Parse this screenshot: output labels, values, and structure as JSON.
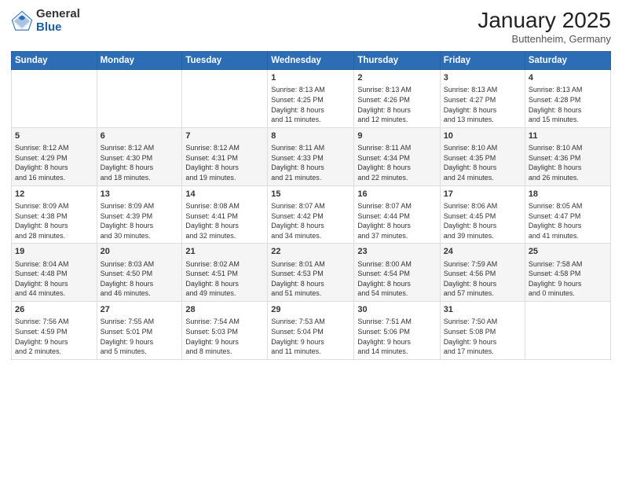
{
  "logo": {
    "general": "General",
    "blue": "Blue"
  },
  "header": {
    "month": "January 2025",
    "location": "Buttenheim, Germany"
  },
  "weekdays": [
    "Sunday",
    "Monday",
    "Tuesday",
    "Wednesday",
    "Thursday",
    "Friday",
    "Saturday"
  ],
  "weeks": [
    [
      {
        "day": "",
        "info": ""
      },
      {
        "day": "",
        "info": ""
      },
      {
        "day": "",
        "info": ""
      },
      {
        "day": "1",
        "info": "Sunrise: 8:13 AM\nSunset: 4:25 PM\nDaylight: 8 hours\nand 11 minutes."
      },
      {
        "day": "2",
        "info": "Sunrise: 8:13 AM\nSunset: 4:26 PM\nDaylight: 8 hours\nand 12 minutes."
      },
      {
        "day": "3",
        "info": "Sunrise: 8:13 AM\nSunset: 4:27 PM\nDaylight: 8 hours\nand 13 minutes."
      },
      {
        "day": "4",
        "info": "Sunrise: 8:13 AM\nSunset: 4:28 PM\nDaylight: 8 hours\nand 15 minutes."
      }
    ],
    [
      {
        "day": "5",
        "info": "Sunrise: 8:12 AM\nSunset: 4:29 PM\nDaylight: 8 hours\nand 16 minutes."
      },
      {
        "day": "6",
        "info": "Sunrise: 8:12 AM\nSunset: 4:30 PM\nDaylight: 8 hours\nand 18 minutes."
      },
      {
        "day": "7",
        "info": "Sunrise: 8:12 AM\nSunset: 4:31 PM\nDaylight: 8 hours\nand 19 minutes."
      },
      {
        "day": "8",
        "info": "Sunrise: 8:11 AM\nSunset: 4:33 PM\nDaylight: 8 hours\nand 21 minutes."
      },
      {
        "day": "9",
        "info": "Sunrise: 8:11 AM\nSunset: 4:34 PM\nDaylight: 8 hours\nand 22 minutes."
      },
      {
        "day": "10",
        "info": "Sunrise: 8:10 AM\nSunset: 4:35 PM\nDaylight: 8 hours\nand 24 minutes."
      },
      {
        "day": "11",
        "info": "Sunrise: 8:10 AM\nSunset: 4:36 PM\nDaylight: 8 hours\nand 26 minutes."
      }
    ],
    [
      {
        "day": "12",
        "info": "Sunrise: 8:09 AM\nSunset: 4:38 PM\nDaylight: 8 hours\nand 28 minutes."
      },
      {
        "day": "13",
        "info": "Sunrise: 8:09 AM\nSunset: 4:39 PM\nDaylight: 8 hours\nand 30 minutes."
      },
      {
        "day": "14",
        "info": "Sunrise: 8:08 AM\nSunset: 4:41 PM\nDaylight: 8 hours\nand 32 minutes."
      },
      {
        "day": "15",
        "info": "Sunrise: 8:07 AM\nSunset: 4:42 PM\nDaylight: 8 hours\nand 34 minutes."
      },
      {
        "day": "16",
        "info": "Sunrise: 8:07 AM\nSunset: 4:44 PM\nDaylight: 8 hours\nand 37 minutes."
      },
      {
        "day": "17",
        "info": "Sunrise: 8:06 AM\nSunset: 4:45 PM\nDaylight: 8 hours\nand 39 minutes."
      },
      {
        "day": "18",
        "info": "Sunrise: 8:05 AM\nSunset: 4:47 PM\nDaylight: 8 hours\nand 41 minutes."
      }
    ],
    [
      {
        "day": "19",
        "info": "Sunrise: 8:04 AM\nSunset: 4:48 PM\nDaylight: 8 hours\nand 44 minutes."
      },
      {
        "day": "20",
        "info": "Sunrise: 8:03 AM\nSunset: 4:50 PM\nDaylight: 8 hours\nand 46 minutes."
      },
      {
        "day": "21",
        "info": "Sunrise: 8:02 AM\nSunset: 4:51 PM\nDaylight: 8 hours\nand 49 minutes."
      },
      {
        "day": "22",
        "info": "Sunrise: 8:01 AM\nSunset: 4:53 PM\nDaylight: 8 hours\nand 51 minutes."
      },
      {
        "day": "23",
        "info": "Sunrise: 8:00 AM\nSunset: 4:54 PM\nDaylight: 8 hours\nand 54 minutes."
      },
      {
        "day": "24",
        "info": "Sunrise: 7:59 AM\nSunset: 4:56 PM\nDaylight: 8 hours\nand 57 minutes."
      },
      {
        "day": "25",
        "info": "Sunrise: 7:58 AM\nSunset: 4:58 PM\nDaylight: 9 hours\nand 0 minutes."
      }
    ],
    [
      {
        "day": "26",
        "info": "Sunrise: 7:56 AM\nSunset: 4:59 PM\nDaylight: 9 hours\nand 2 minutes."
      },
      {
        "day": "27",
        "info": "Sunrise: 7:55 AM\nSunset: 5:01 PM\nDaylight: 9 hours\nand 5 minutes."
      },
      {
        "day": "28",
        "info": "Sunrise: 7:54 AM\nSunset: 5:03 PM\nDaylight: 9 hours\nand 8 minutes."
      },
      {
        "day": "29",
        "info": "Sunrise: 7:53 AM\nSunset: 5:04 PM\nDaylight: 9 hours\nand 11 minutes."
      },
      {
        "day": "30",
        "info": "Sunrise: 7:51 AM\nSunset: 5:06 PM\nDaylight: 9 hours\nand 14 minutes."
      },
      {
        "day": "31",
        "info": "Sunrise: 7:50 AM\nSunset: 5:08 PM\nDaylight: 9 hours\nand 17 minutes."
      },
      {
        "day": "",
        "info": ""
      }
    ]
  ]
}
